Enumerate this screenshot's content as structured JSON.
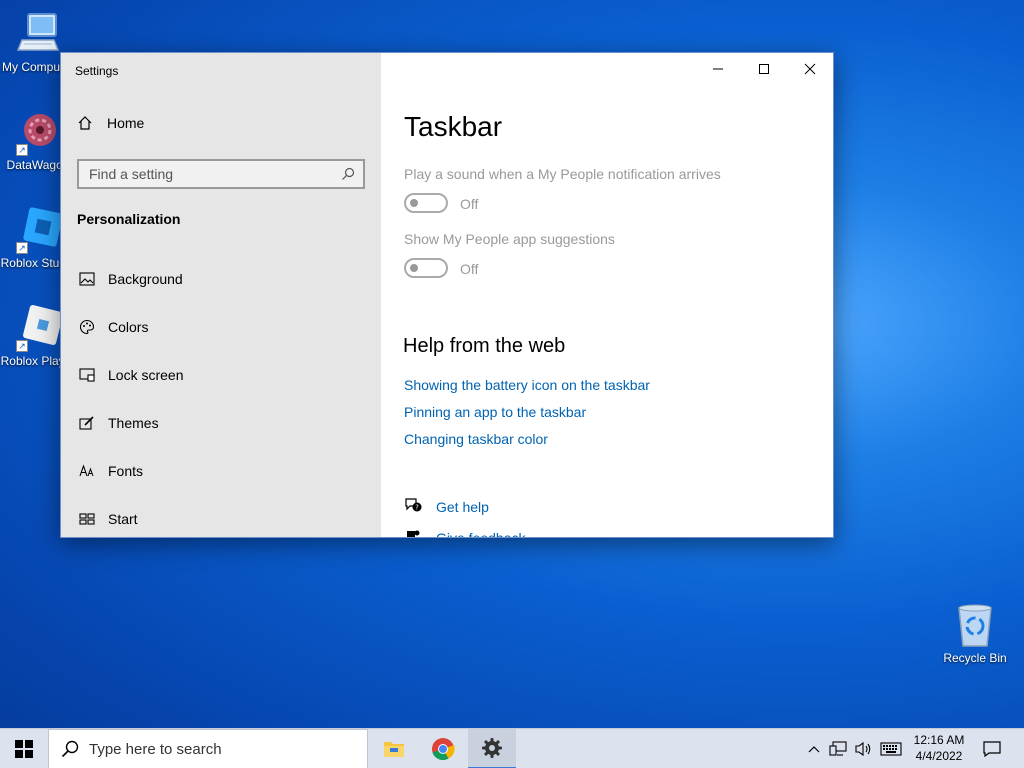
{
  "desktop": {
    "icons": [
      {
        "label": "My Computer"
      },
      {
        "label": "DataWagon"
      },
      {
        "label": "Roblox Studio"
      },
      {
        "label": "Roblox Player"
      }
    ],
    "recycle_bin": {
      "label": "Recycle Bin"
    }
  },
  "window": {
    "title": "Settings",
    "sidebar": {
      "home_label": "Home",
      "search_placeholder": "Find a setting",
      "section_title": "Personalization",
      "items": [
        {
          "label": "Background",
          "icon": "image-icon"
        },
        {
          "label": "Colors",
          "icon": "palette-icon"
        },
        {
          "label": "Lock screen",
          "icon": "lock-screen-icon"
        },
        {
          "label": "Themes",
          "icon": "themes-icon"
        },
        {
          "label": "Fonts",
          "icon": "fonts-icon"
        },
        {
          "label": "Start",
          "icon": "start-icon"
        }
      ]
    },
    "content": {
      "page_title": "Taskbar",
      "settings": [
        {
          "label": "Play a sound when a My People notification arrives",
          "state": "Off"
        },
        {
          "label": "Show My People app suggestions",
          "state": "Off"
        }
      ],
      "help": {
        "title": "Help from the web",
        "links": [
          "Showing the battery icon on the taskbar",
          "Pinning an app to the taskbar",
          "Changing taskbar color"
        ]
      },
      "actions": [
        {
          "label": "Get help",
          "icon": "get-help-icon"
        },
        {
          "label": "Give feedback",
          "icon": "feedback-icon"
        }
      ]
    }
  },
  "taskbar": {
    "search_placeholder": "Type here to search",
    "apps": [
      {
        "name": "file-explorer-icon"
      },
      {
        "name": "chrome-icon"
      },
      {
        "name": "settings-gear-icon",
        "active": true
      }
    ],
    "clock": {
      "time": "12:16 AM",
      "date": "4/4/2022"
    }
  },
  "colors": {
    "accent": "#0063b1",
    "sidebar_bg": "#e6e6e6",
    "taskbar_bg": "#dde3ee"
  }
}
